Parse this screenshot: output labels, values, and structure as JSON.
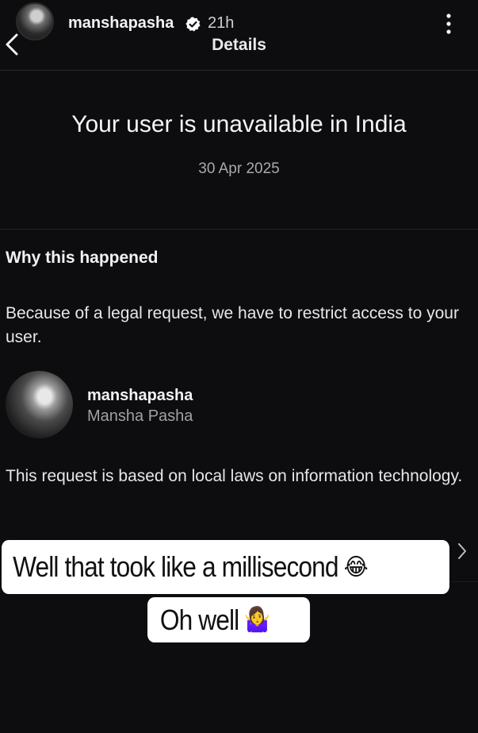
{
  "header": {
    "username": "manshapasha",
    "time": "21h",
    "title": "Details"
  },
  "notice": {
    "headline": "Your user is unavailable in India",
    "date": "30 Apr 2025"
  },
  "why": {
    "heading": "Why this happened",
    "reason": "Because of a legal request, we have to restrict access to your user.",
    "account": {
      "handle": "manshapasha",
      "name": "Mansha Pasha"
    },
    "basis": "This request is based on local laws on information technology."
  },
  "stickers": {
    "line1": "Well that took like a millisecond",
    "line1_emoji": "😂",
    "line2": "Oh well",
    "line2_emoji": "🤷‍♀️"
  },
  "icons": {
    "back": "chevron-left-icon",
    "verified": "verified-badge-icon",
    "more": "more-vertical-icon",
    "row": "chevron-right-icon"
  },
  "colors": {
    "background": "#0d0d0f",
    "verified_badge": "#ffffff",
    "sticker_bg": "#ffffff"
  }
}
